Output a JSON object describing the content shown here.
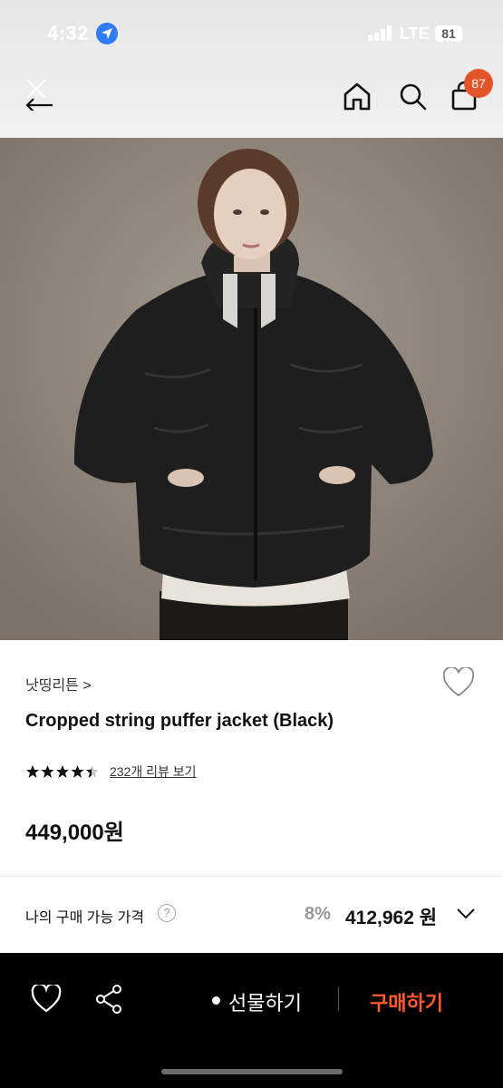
{
  "status_bar": {
    "time": "4:32",
    "network": "LTE",
    "battery": "81"
  },
  "nav": {
    "cart_count": "87"
  },
  "product": {
    "brand": "낫띵리튼 >",
    "title": "Cropped string puffer jacket (Black)",
    "rating": 4.5,
    "review_link": "232개 리뷰 보기",
    "price": "449,000원"
  },
  "my_price": {
    "label": "나의 구매 가능 가격",
    "help": "?",
    "discount_rate": "8%",
    "discounted_price": "412,962 원"
  },
  "action_bar": {
    "gift_label": "선물하기",
    "buy_label": "구매하기"
  },
  "colors": {
    "accent": "#ff5a2c",
    "cart_badge": "#e2552a",
    "location": "#2f7cf6"
  }
}
